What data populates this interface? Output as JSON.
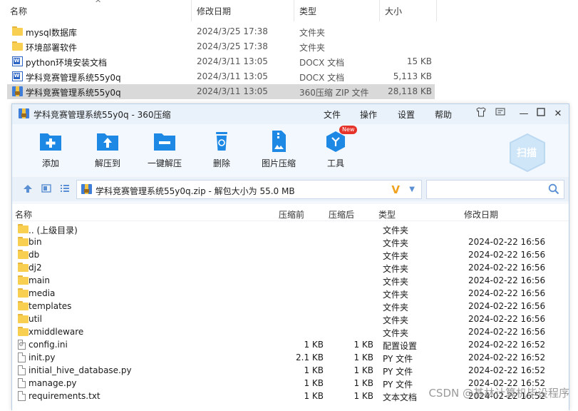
{
  "explorer": {
    "columns": {
      "name": "名称",
      "date": "修改日期",
      "type": "类型",
      "size": "大小"
    },
    "rows": [
      {
        "icon": "folder-icon",
        "name": "mysql数据库",
        "date": "2024/3/25 17:38",
        "type": "文件夹",
        "size": ""
      },
      {
        "icon": "folder-icon",
        "name": "环境部署软件",
        "date": "2024/3/25 17:38",
        "type": "文件夹",
        "size": ""
      },
      {
        "icon": "word-doc-icon",
        "name": "python环境安装文档",
        "date": "2024/3/11 13:05",
        "type": "DOCX 文档",
        "size": "15 KB"
      },
      {
        "icon": "word-doc-icon",
        "name": "学科竞赛管理系统55y0q",
        "date": "2024/3/11 13:05",
        "type": "DOCX 文档",
        "size": "5,113 KB"
      },
      {
        "icon": "zip-archive-icon",
        "name": "学科竞赛管理系统55y0q",
        "date": "2024/3/11 13:05",
        "type": "360压缩 ZIP 文件",
        "size": "28,118 KB",
        "selected": true
      }
    ]
  },
  "archive_window": {
    "title": "学科竞赛管理系统55y0q - 360压缩",
    "menu": {
      "file": "文件",
      "operate": "操作",
      "settings": "设置",
      "help": "帮助"
    },
    "toolbar": {
      "add": "添加",
      "extract_to": "解压到",
      "one_click_extract": "一键解压",
      "delete": "删除",
      "image_compress": "图片压缩",
      "tools": "工具",
      "new_badge": "New",
      "scan": "扫描"
    },
    "address": {
      "path": "学科竞赛管理系统55y0q.zip - 解包大小为 55.0 MB",
      "search_placeholder": ""
    },
    "list_columns": {
      "name": "名称",
      "before": "压缩前",
      "after": "压缩后",
      "type": "类型",
      "date": "修改日期"
    },
    "rows": [
      {
        "icon": "folder-icon",
        "name": ".. (上级目录)",
        "before": "",
        "after": "",
        "type": "文件夹",
        "date": ""
      },
      {
        "icon": "folder-icon",
        "name": "bin",
        "before": "",
        "after": "",
        "type": "文件夹",
        "date": "2024-02-22 16:56"
      },
      {
        "icon": "folder-icon",
        "name": "db",
        "before": "",
        "after": "",
        "type": "文件夹",
        "date": "2024-02-22 16:56"
      },
      {
        "icon": "folder-icon",
        "name": "dj2",
        "before": "",
        "after": "",
        "type": "文件夹",
        "date": "2024-02-22 16:56"
      },
      {
        "icon": "folder-icon",
        "name": "main",
        "before": "",
        "after": "",
        "type": "文件夹",
        "date": "2024-02-22 16:56"
      },
      {
        "icon": "folder-icon",
        "name": "media",
        "before": "",
        "after": "",
        "type": "文件夹",
        "date": "2024-02-22 16:56"
      },
      {
        "icon": "folder-icon",
        "name": "templates",
        "before": "",
        "after": "",
        "type": "文件夹",
        "date": "2024-02-22 16:56"
      },
      {
        "icon": "folder-icon",
        "name": "util",
        "before": "",
        "after": "",
        "type": "文件夹",
        "date": "2024-02-22 16:56"
      },
      {
        "icon": "folder-icon",
        "name": "xmiddleware",
        "before": "",
        "after": "",
        "type": "文件夹",
        "date": "2024-02-22 16:56"
      },
      {
        "icon": "config-file-icon",
        "name": "config.ini",
        "before": "1 KB",
        "after": "1 KB",
        "type": "配置设置",
        "date": "2024-02-22 16:52"
      },
      {
        "icon": "file-icon",
        "name": "init.py",
        "before": "2.1 KB",
        "after": "1 KB",
        "type": "PY 文件",
        "date": "2024-02-22 16:52"
      },
      {
        "icon": "file-icon",
        "name": "initial_hive_database.py",
        "before": "1 KB",
        "after": "1 KB",
        "type": "PY 文件",
        "date": "2024-02-22 16:52"
      },
      {
        "icon": "file-icon",
        "name": "manage.py",
        "before": "1 KB",
        "after": "1 KB",
        "type": "PY 文件",
        "date": "2024-02-22 16:52"
      },
      {
        "icon": "file-icon",
        "name": "requirements.txt",
        "before": "1 KB",
        "after": "1 KB",
        "type": "文本文档",
        "date": "2024-02-22 16:52"
      }
    ]
  },
  "watermark": "CSDN @基林计算机毕设程序",
  "colors": {
    "accent": "#1e88e5",
    "folder": "#f9cf52",
    "selected_row": "#d9d9d9",
    "new_badge": "#e6332a"
  }
}
